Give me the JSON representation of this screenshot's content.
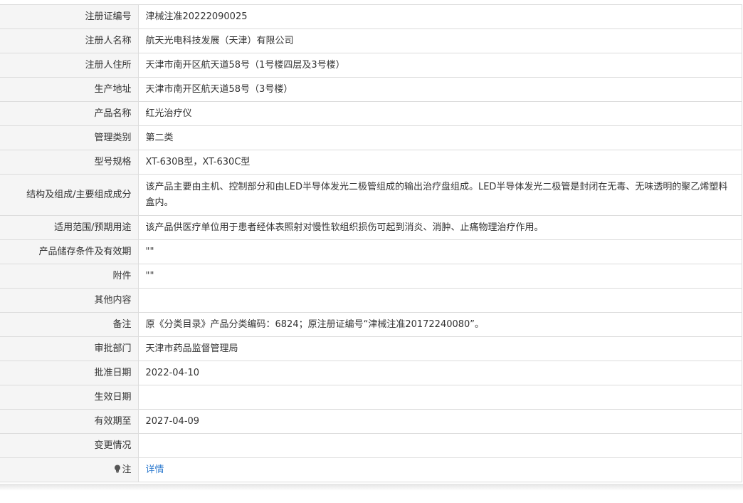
{
  "rows": [
    {
      "label": "注册证编号",
      "value": "津械注准20222090025"
    },
    {
      "label": "注册人名称",
      "value": "航天光电科技发展（天津）有限公司"
    },
    {
      "label": "注册人住所",
      "value": "天津市南开区航天道58号（1号楼四层及3号楼）"
    },
    {
      "label": "生产地址",
      "value": "天津市南开区航天道58号（3号楼）"
    },
    {
      "label": "产品名称",
      "value": "红光治疗仪"
    },
    {
      "label": "管理类别",
      "value": "第二类"
    },
    {
      "label": "型号规格",
      "value": "XT-630B型，XT-630C型"
    },
    {
      "label": "结构及组成/主要组成成分",
      "value": "该产品主要由主机、控制部分和由LED半导体发光二极管组成的输出治疗盘组成。LED半导体发光二极管是封闭在无毒、无味透明的聚乙烯塑料盒内。"
    },
    {
      "label": "适用范围/预期用途",
      "value": "该产品供医疗单位用于患者经体表照射对慢性软组织损伤可起到消炎、消肿、止痛物理治疗作用。"
    },
    {
      "label": "产品储存条件及有效期",
      "value": "\"\""
    },
    {
      "label": "附件",
      "value": "\"\""
    },
    {
      "label": "其他内容",
      "value": ""
    },
    {
      "label": "备注",
      "value": "原《分类目录》产品分类编码：6824；原注册证编号“津械注准20172240080”。"
    },
    {
      "label": "审批部门",
      "value": "天津市药品监督管理局"
    },
    {
      "label": "批准日期",
      "value": "2022-04-10"
    },
    {
      "label": "生效日期",
      "value": ""
    },
    {
      "label": "有效期至",
      "value": "2027-04-09"
    },
    {
      "label": "变更情况",
      "value": ""
    }
  ],
  "note_row": {
    "label": "注",
    "icon": "lightbulb-icon",
    "link_text": "详情",
    "link_color": "#2e7bcf"
  }
}
